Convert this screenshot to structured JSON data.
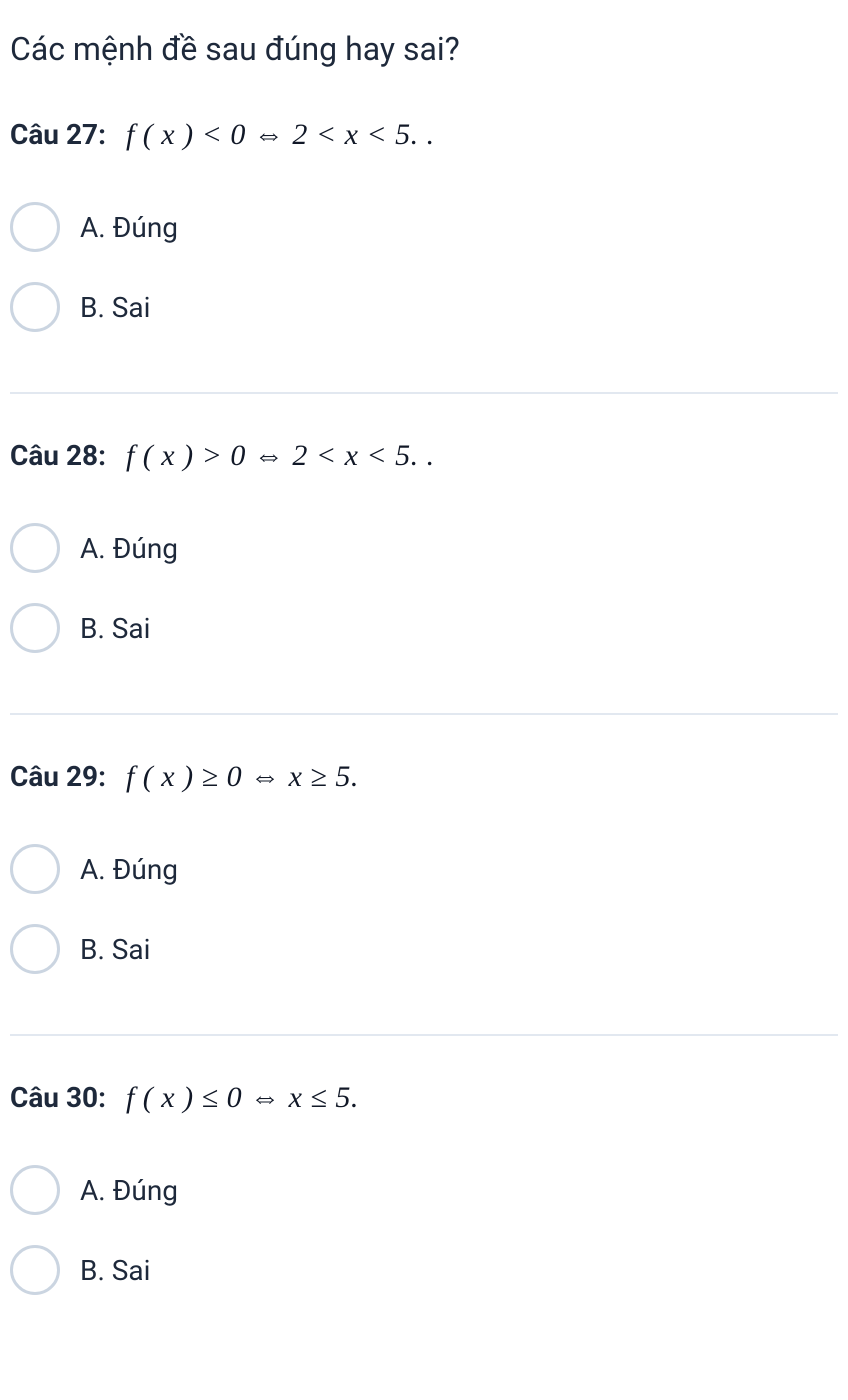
{
  "header": "Các mệnh đề sau đúng hay sai?",
  "questions": [
    {
      "label": "Câu 27:",
      "math": "f ( x ) < 0 ⇔  2 < x < 5. .",
      "options": [
        {
          "letter": "A.",
          "text": "Đúng"
        },
        {
          "letter": "B.",
          "text": "Sai"
        }
      ]
    },
    {
      "label": "Câu 28:",
      "math": "f ( x ) > 0 ⇔  2 < x < 5. .",
      "options": [
        {
          "letter": "A.",
          "text": "Đúng"
        },
        {
          "letter": "B.",
          "text": "Sai"
        }
      ]
    },
    {
      "label": "Câu 29:",
      "math": "f ( x ) ≥ 0 ⇔  x ≥ 5.",
      "options": [
        {
          "letter": "A.",
          "text": "Đúng"
        },
        {
          "letter": "B.",
          "text": "Sai"
        }
      ]
    },
    {
      "label": "Câu 30:",
      "math": "f ( x ) ≤ 0 ⇔  x ≤ 5.",
      "options": [
        {
          "letter": "A.",
          "text": "Đúng"
        },
        {
          "letter": "B.",
          "text": "Sai"
        }
      ]
    }
  ]
}
